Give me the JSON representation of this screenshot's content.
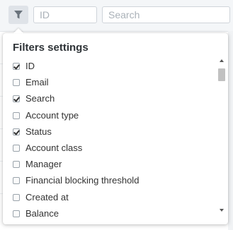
{
  "toolbar": {
    "filter_icon": "filter-icon",
    "id_placeholder": "ID",
    "search_placeholder": "Search"
  },
  "filters_panel": {
    "title": "Filters settings",
    "items": [
      {
        "label": "ID",
        "checked": true
      },
      {
        "label": "Email",
        "checked": false
      },
      {
        "label": "Search",
        "checked": true
      },
      {
        "label": "Account type",
        "checked": false
      },
      {
        "label": "Status",
        "checked": true
      },
      {
        "label": "Account class",
        "checked": false
      },
      {
        "label": "Manager",
        "checked": false
      },
      {
        "label": "Financial blocking threshold",
        "checked": false
      },
      {
        "label": "Created at",
        "checked": false
      },
      {
        "label": "Balance",
        "checked": false
      }
    ]
  },
  "colors": {
    "toolbar_bg": "#f4f6f8",
    "filter_button_bg": "#dfe3e8",
    "check_color": "#333333",
    "link": "#3a7bc8"
  }
}
